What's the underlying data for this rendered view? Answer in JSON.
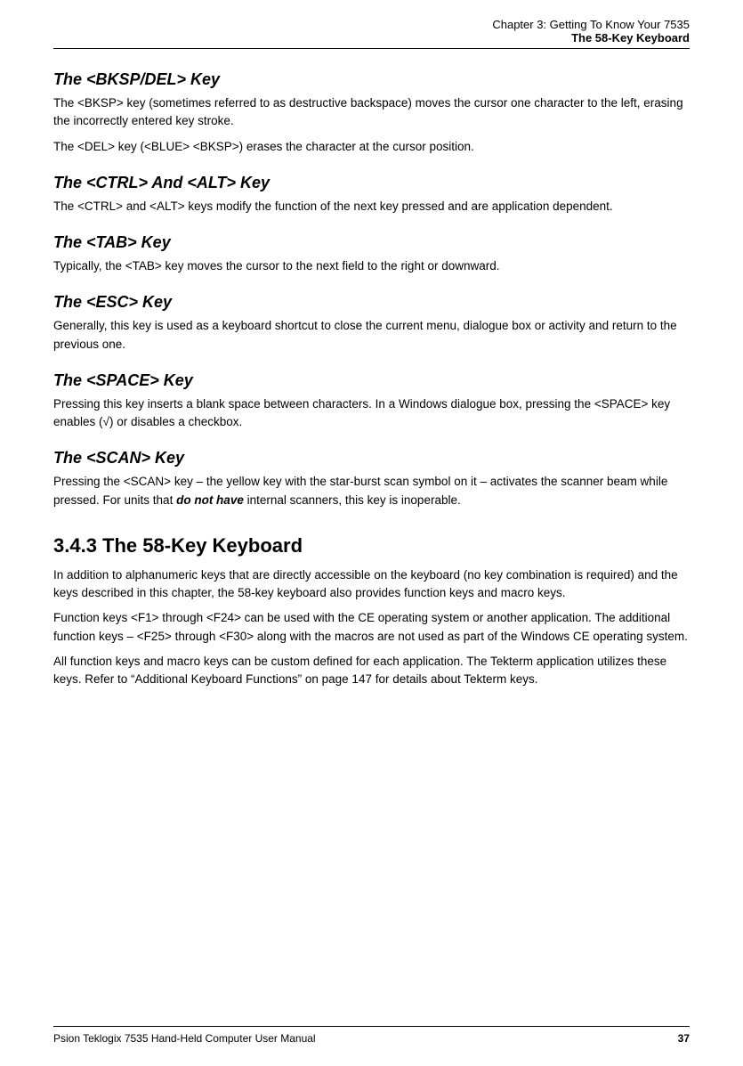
{
  "header": {
    "line1": "Chapter  3:  Getting To Know Your 7535",
    "line2": "The 58-Key Keyboard"
  },
  "sections": [
    {
      "id": "bksp",
      "heading": "The  <BKSP/DEL>  Key",
      "paragraphs": [
        "The <BKSP> key (sometimes referred to as destructive backspace) moves the cursor one character to the left, erasing the incorrectly entered key stroke.",
        "The <DEL> key (<BLUE> <BKSP>) erases the character at the cursor position."
      ]
    },
    {
      "id": "ctrl-alt",
      "heading": "The  <CTRL>  And  <ALT>  Key",
      "paragraphs": [
        "The <CTRL> and <ALT> keys modify the function of the next key pressed and are application dependent."
      ]
    },
    {
      "id": "tab",
      "heading": "The  <TAB>  Key",
      "paragraphs": [
        "Typically, the <TAB> key moves the cursor to the next field to the right or downward."
      ]
    },
    {
      "id": "esc",
      "heading": "The  <ESC>  Key",
      "paragraphs": [
        "Generally, this key is used as a keyboard shortcut to close the current menu, dialogue box or activity and return to the previous one."
      ]
    },
    {
      "id": "space",
      "heading": "The  <SPACE>  Key",
      "paragraphs": [
        "Pressing this key inserts a blank space between characters. In a Windows dialogue box, pressing the <SPACE> key enables (√) or disables a checkbox."
      ]
    },
    {
      "id": "scan",
      "heading": "The  <SCAN>  Key",
      "paragraphs": [
        "Pressing the <SCAN> key – the yellow key with the star-burst scan symbol on it – activates the scanner beam while pressed. For units that [bold]do not have[/bold] internal scanners, this key is inoperable."
      ]
    }
  ],
  "section341": {
    "heading": "3.4.3   The  58-Key  Keyboard",
    "paragraphs": [
      "In addition to alphanumeric keys that are directly accessible on the keyboard (no key combination is required) and the keys described in this chapter, the 58-key keyboard also provides function keys and macro keys.",
      "Function keys <F1> through <F24> can be used with the CE operating system or another application. The additional function keys – <F25> through <F30> along with the macros are not used as part of the Windows CE operating system.",
      "All function keys and macro keys can be custom defined for each application. The Tekterm application utilizes these keys. Refer to “Additional Keyboard Functions” on page 147 for details about Tekterm keys."
    ]
  },
  "footer": {
    "left": "Psion Teklogix 7535 Hand-Held Computer User Manual",
    "right": "37"
  }
}
